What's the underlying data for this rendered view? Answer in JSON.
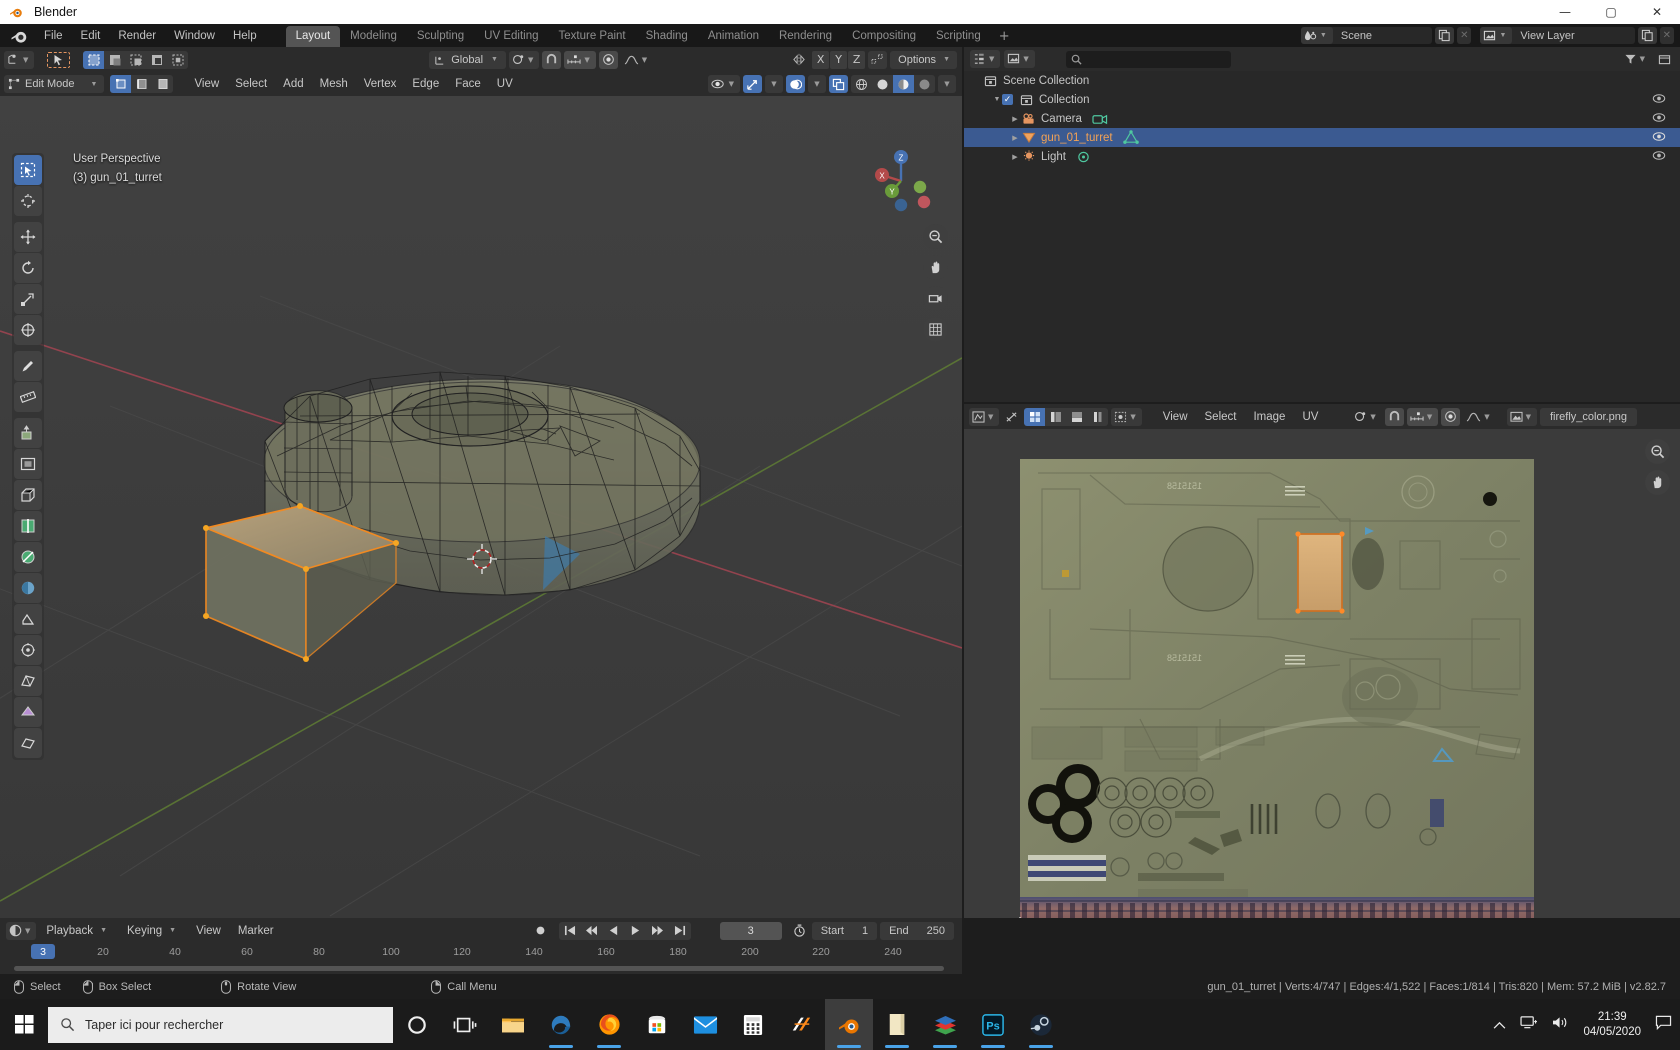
{
  "window": {
    "title": "Blender",
    "logo_icon": "blender-logo-icon",
    "minimize": "—",
    "maximize": "▢",
    "close": "✕"
  },
  "topbar": {
    "menus": [
      "File",
      "Edit",
      "Render",
      "Window",
      "Help"
    ],
    "workspaces": [
      {
        "label": "Layout",
        "active": true
      },
      {
        "label": "Modeling",
        "active": false
      },
      {
        "label": "Sculpting",
        "active": false
      },
      {
        "label": "UV Editing",
        "active": false
      },
      {
        "label": "Texture Paint",
        "active": false
      },
      {
        "label": "Shading",
        "active": false
      },
      {
        "label": "Animation",
        "active": false
      },
      {
        "label": "Rendering",
        "active": false
      },
      {
        "label": "Compositing",
        "active": false
      },
      {
        "label": "Scripting",
        "active": false
      }
    ],
    "add_workspace": "+",
    "scene": {
      "icon": "scene-icon",
      "name": "Scene",
      "copy_icon": "duplicate-icon",
      "unlink_icon": "unlink-icon"
    },
    "view_layer": {
      "icon": "view-layer-icon",
      "name": "View Layer"
    }
  },
  "viewport": {
    "header": {
      "editor_type_icon": "editor-type-icon",
      "tool_icon": "tweak-tool-icon",
      "select_modes": [
        "set",
        "extend",
        "subtract",
        "invert",
        "intersect"
      ],
      "orientation": {
        "label": "Global",
        "icon": "orientation-icon"
      },
      "snap_icon": "magnet-icon",
      "snap_target_icon": "snap-increment-icon",
      "pivot_icon": "pivot-median-icon",
      "proportional_icon": "proportional-falloff-icon",
      "mirror_label": "mirror",
      "axes": [
        "X",
        "Y",
        "Z"
      ],
      "options_label": "Options"
    },
    "header2": {
      "mode": "Edit Mode",
      "mesh_select_modes": [
        "vertex",
        "edge",
        "face"
      ],
      "menus": [
        "View",
        "Select",
        "Add",
        "Mesh",
        "Vertex",
        "Edge",
        "Face",
        "UV"
      ],
      "visibility_icon": "visibility-icon",
      "gizmo_icon": "gizmo-icon",
      "overlays_icon": "overlays-icon",
      "xray_icon": "xray-icon",
      "shading_modes": [
        "wireframe",
        "solid",
        "material",
        "rendered"
      ]
    },
    "overlay_text_line1": "User Perspective",
    "overlay_text_line2": "(3) gun_01_turret",
    "tools": [
      "select-box-tool",
      "cursor-tool",
      "move-tool",
      "rotate-tool",
      "scale-tool",
      "transform-tool",
      "annotate-tool",
      "measure-tool",
      "extrude-tool",
      "inset-faces-tool",
      "bevel-tool",
      "loop-cut-tool",
      "knife-tool",
      "poly-build-tool",
      "spin-tool",
      "smooth-tool",
      "edge-slide-tool",
      "shrink-fatten-tool",
      "shear-tool",
      "rip-region-tool"
    ],
    "gizmo_axes": {
      "x": "X",
      "y": "Y",
      "z": "Z"
    },
    "nav_buttons": [
      "zoom-icon",
      "pan-icon",
      "camera-icon",
      "ortho-persp-icon"
    ]
  },
  "outliner": {
    "display_mode_icon": "outliner-display-mode-icon",
    "filter_id_icon": "filter-id-icon",
    "search_placeholder": "",
    "search_icon": "search-icon",
    "filter_icon": "funnel-icon",
    "new_collection_icon": "new-collection-icon",
    "rows": [
      {
        "indent": 0,
        "label": "Scene Collection",
        "icon": "collection-icon",
        "icon_color": "#c3c3c3",
        "expander": "",
        "checkbox": false,
        "selected": false,
        "eye": false,
        "tag": null
      },
      {
        "indent": 1,
        "label": "Collection",
        "icon": "collection-icon",
        "icon_color": "#c3c3c3",
        "expander": "▼",
        "checkbox": true,
        "selected": false,
        "eye": true,
        "tag": null
      },
      {
        "indent": 2,
        "label": "Camera",
        "icon": "camera-object-icon",
        "icon_color": "#e59560",
        "expander": "▶",
        "checkbox": false,
        "selected": false,
        "eye": true,
        "tag": "camera-data-icon"
      },
      {
        "indent": 2,
        "label": "gun_01_turret",
        "icon": "mesh-object-icon",
        "icon_color": "#e59560",
        "expander": "▶",
        "checkbox": false,
        "selected": true,
        "eye": true,
        "tag": "mesh-data-icon"
      },
      {
        "indent": 2,
        "label": "Light",
        "icon": "light-object-icon",
        "icon_color": "#e59560",
        "expander": "▶",
        "checkbox": false,
        "selected": false,
        "eye": true,
        "tag": "light-data-icon"
      }
    ]
  },
  "uv_editor": {
    "editor_type_icon": "uv-editor-icon",
    "mode_icon": "uv-mode-icon",
    "select_modes": [
      "vertex",
      "edge",
      "face",
      "island"
    ],
    "sticky_icon": "sticky-selection-icon",
    "menus": [
      "View",
      "Select",
      "Image",
      "UV"
    ],
    "pivot_icon": "pivot-icon",
    "snap_icon": "magnet-icon",
    "snap_target_icon": "snap-increment-icon",
    "proportional_icon": "proportional-edit-icon",
    "falloff_icon": "falloff-icon",
    "image_browse_icon": "image-browse-icon",
    "image_name": "firefly_color.png",
    "nav_buttons": [
      "zoom-icon",
      "pan-icon"
    ],
    "cursor_2d": "2d-cursor-icon",
    "selected_face_color": "#e8a85a",
    "selected_outline_color": "#ff8a28"
  },
  "timeline": {
    "editor_type_icon": "timeline-icon",
    "menus_dropdowns": [
      "Playback",
      "Keying"
    ],
    "menus": [
      "View",
      "Marker"
    ],
    "record_icon": "record-icon",
    "transport": [
      "jump-to-start",
      "prev-keyframe",
      "play-reverse",
      "play",
      "next-keyframe",
      "jump-to-end"
    ],
    "current_frame": "3",
    "timer_icon": "auto-key-icon",
    "start_label": "Start",
    "start_value": "1",
    "end_label": "End",
    "end_value": "250",
    "ticks": [
      "20",
      "40",
      "60",
      "80",
      "100",
      "120",
      "140",
      "160",
      "180",
      "200",
      "220",
      "240"
    ],
    "playhead_label": "3"
  },
  "statusbar": {
    "mouse_hints": [
      {
        "icon": "mouse-left-icon",
        "label": "Select"
      },
      {
        "icon": "mouse-left-drag-icon",
        "label": "Box Select"
      },
      {
        "icon": "mouse-middle-icon",
        "label": "Rotate View"
      },
      {
        "icon": "mouse-right-icon",
        "label": "Call Menu"
      }
    ],
    "scene_stats": "gun_01_turret | Verts:4/747 | Edges:4/1,522 | Faces:1/814 | Tris:820 | Mem: 57.2 MiB | v2.82.7"
  },
  "taskbar": {
    "start_icon": "windows-start-icon",
    "search_icon": "search-icon",
    "search_placeholder": "Taper ici pour rechercher",
    "cortana_icon": "cortana-icon",
    "taskview_icon": "task-view-icon",
    "apps": [
      {
        "icon": "file-explorer-icon",
        "running": false,
        "active": false
      },
      {
        "icon": "edge-icon",
        "running": true,
        "active": false
      },
      {
        "icon": "firefox-icon",
        "running": true,
        "active": false
      },
      {
        "icon": "microsoft-store-icon",
        "running": false,
        "active": false
      },
      {
        "icon": "mail-icon",
        "running": false,
        "active": false
      },
      {
        "icon": "calculator-icon",
        "running": false,
        "active": false
      },
      {
        "icon": "winamp-icon",
        "running": false,
        "active": false
      },
      {
        "icon": "blender-icon",
        "running": true,
        "active": true
      },
      {
        "icon": "notepad-icon",
        "running": true,
        "active": false
      },
      {
        "icon": "winrar-icon",
        "running": true,
        "active": false
      },
      {
        "icon": "photoshop-icon",
        "running": true,
        "active": false
      },
      {
        "icon": "steam-icon",
        "running": true,
        "active": false
      }
    ],
    "tray": {
      "chevron_icon": "show-hidden-icons-icon",
      "network_icon": "network-icon",
      "volume_icon": "volume-icon",
      "time": "21:39",
      "date": "04/05/2020",
      "notification_icon": "action-center-icon"
    }
  },
  "colors": {
    "accent": "#4772b3",
    "selection_orange": "#f3a255",
    "header_bg": "#2b2b2b",
    "viewport_bg": "#3b3b3b",
    "panel_bg": "#282828"
  }
}
